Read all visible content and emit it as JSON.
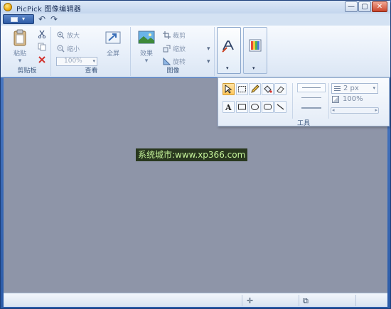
{
  "window": {
    "title": "PicPick 图像编辑器",
    "buttons": [
      "—",
      "▢",
      "✕"
    ]
  },
  "quick_access": {
    "undo": "↶",
    "redo": "↷"
  },
  "ribbon": {
    "clipboard": {
      "label": "剪贴板",
      "paste": "粘贴",
      "paste_arrow": "▾"
    },
    "view": {
      "label": "查看",
      "zoom_in": "放大",
      "zoom_out": "缩小",
      "zoom_value": "100%",
      "fullscreen": "全屏"
    },
    "image": {
      "label": "图像",
      "effects": "效果",
      "effects_arrow": "▾",
      "crop": "裁剪",
      "resize": "缩放",
      "rotate": "旋转"
    },
    "tools_arrow": "▾",
    "color_arrow": "▾"
  },
  "tools_popup": {
    "label": "工具",
    "line_width": "2 px",
    "opacity": "100%"
  },
  "watermark": "系统城市:www.xp366.com",
  "statusbar": {
    "move_icon": "✛",
    "size_icon": "⧉"
  },
  "colors": {
    "canvas": "#8e95a8",
    "ribbon": "#e6eef9",
    "highlight": "#ffc75c"
  }
}
